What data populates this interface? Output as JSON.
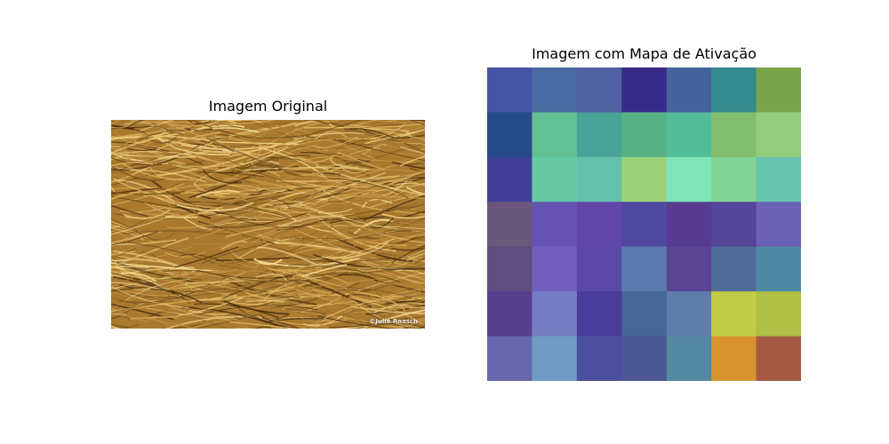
{
  "titles": {
    "left": "Imagem Original",
    "right": "Imagem com Mapa de Ativação"
  },
  "original_image": {
    "description_icon": "dry-grass-photo",
    "watermark": "©Julie Raasch",
    "base_color": "#a9792f",
    "highlight_color": "#e9c36f",
    "shadow_color": "#4b3112"
  },
  "chart_data": {
    "type": "heatmap",
    "title": "Imagem com Mapa de Ativação",
    "rows": 7,
    "cols": 7,
    "grid": false,
    "cell_colors": [
      [
        "#4453a2",
        "#4a6aa2",
        "#5060a0",
        "#382a8a",
        "#45649c",
        "#358a90",
        "#7aa64b"
      ],
      [
        "#254c88",
        "#63bf94",
        "#48a295",
        "#56b283",
        "#52bb98",
        "#83be6e",
        "#93cc7c"
      ],
      [
        "#413f98",
        "#67c9a6",
        "#63c1ac",
        "#9cd277",
        "#7fe5b9",
        "#80d496",
        "#66c4ac"
      ],
      [
        "#6a577c",
        "#6554b0",
        "#6247ab",
        "#4f4a9e",
        "#583c92",
        "#534597",
        "#6a61b4"
      ],
      [
        "#5e4e7e",
        "#725fbd",
        "#5a4aa5",
        "#5c7aae",
        "#5a4595",
        "#506b97",
        "#4f89a6"
      ],
      [
        "#563f8e",
        "#747dc4",
        "#493c9b",
        "#476799",
        "#5f7eac",
        "#c2cd46",
        "#b0c044"
      ],
      [
        "#6866ae",
        "#719bc5",
        "#4c4f9e",
        "#4b5894",
        "#538aa2",
        "#d89331",
        "#a55943"
      ]
    ]
  }
}
